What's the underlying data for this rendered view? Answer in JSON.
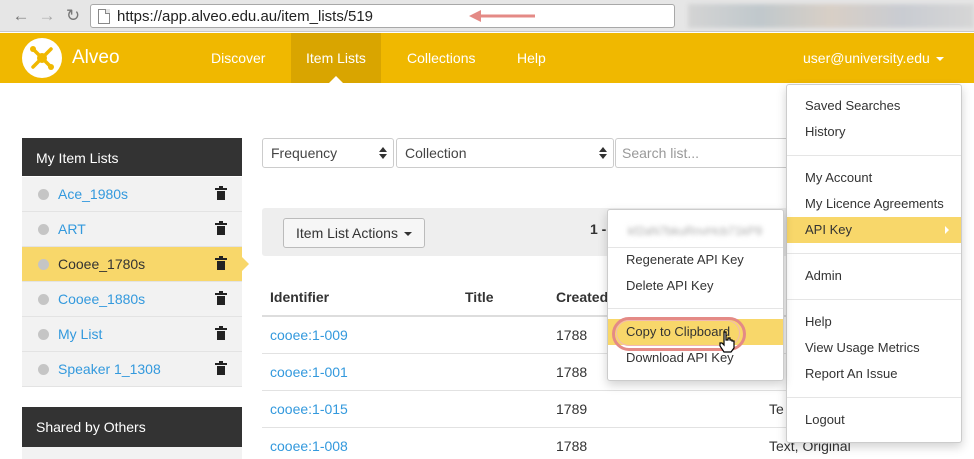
{
  "browser": {
    "url_protocol": "https://",
    "url_domain": "app.alveo.edu.au",
    "url_path": "/item_lists/519"
  },
  "navbar": {
    "brand": "Alveo",
    "items": [
      {
        "label": "Discover"
      },
      {
        "label": "Item Lists"
      },
      {
        "label": "Collections"
      },
      {
        "label": "Help"
      }
    ],
    "user": "user@university.edu",
    "accent_color": "#f0b800"
  },
  "sidebar": {
    "my_lists_title": "My Item Lists",
    "lists": [
      {
        "label": "Ace_1980s"
      },
      {
        "label": "ART"
      },
      {
        "label": "Cooee_1780s"
      },
      {
        "label": "Cooee_1880s"
      },
      {
        "label": "My List"
      },
      {
        "label": "Speaker 1_1308"
      }
    ],
    "shared_title": "Shared by Others"
  },
  "filters": {
    "frequency": "Frequency",
    "collection": "Collection",
    "search_placeholder": "Search list..."
  },
  "actions": {
    "button_label": "Item List Actions",
    "pager_text": "1 -"
  },
  "table": {
    "headers": {
      "identifier": "Identifier",
      "title": "Title",
      "created": "Created"
    },
    "rows": [
      {
        "identifier": "cooee:1-009",
        "created": "1788",
        "type": ""
      },
      {
        "identifier": "cooee:1-001",
        "created": "1788",
        "type": ""
      },
      {
        "identifier": "cooee:1-015",
        "created": "1789",
        "type": "Te"
      },
      {
        "identifier": "cooee:1-008",
        "created": "1788",
        "type": "Text, Original"
      }
    ]
  },
  "user_menu": {
    "saved_searches": "Saved Searches",
    "history": "History",
    "my_account": "My Account",
    "licence_agreements": "My Licence Agreements",
    "api_key": "API Key",
    "admin": "Admin",
    "help": "Help",
    "usage_metrics": "View Usage Metrics",
    "report_issue": "Report An Issue",
    "logout": "Logout"
  },
  "api_menu": {
    "api_key_value": "kf2aN7bkuRnvHcb71kP9",
    "regenerate": "Regenerate API Key",
    "delete": "Delete API Key",
    "copy": "Copy to Clipboard",
    "download": "Download API Key"
  }
}
